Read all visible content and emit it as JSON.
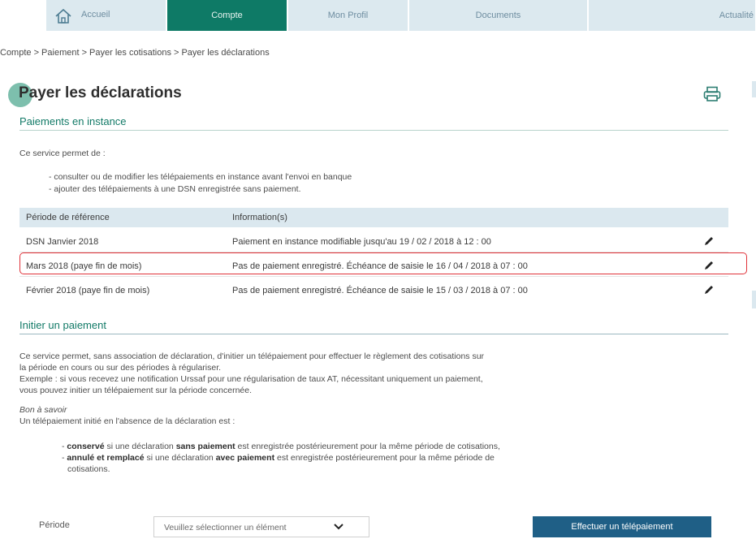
{
  "nav": {
    "items": [
      {
        "label": "Accueil"
      },
      {
        "label": "Compte"
      },
      {
        "label": "Mon Profil"
      },
      {
        "label": "Documents"
      },
      {
        "label": "Actualité"
      }
    ]
  },
  "breadcrumb": "Compte > Paiement > Payer les cotisations > Payer les déclarations",
  "page_title": "Payer les déclarations",
  "pending": {
    "title": "Paiements en instance",
    "intro": "Ce service permet de :",
    "bullets": [
      "- consulter ou de modifier les télépaiements en instance avant l'envoi en banque",
      "- ajouter des télépaiements à une DSN enregistrée sans paiement."
    ],
    "table": {
      "headers": [
        "Période de référence",
        "Information(s)"
      ],
      "rows": [
        {
          "period": "DSN Janvier 2018",
          "info": "Paiement en instance modifiable jusqu'au 19 / 02 / 2018  à  12 : 00"
        },
        {
          "period": "Mars 2018 (paye fin de mois)",
          "info": "Pas de paiement enregistré. Échéance de saisie le 16 / 04 / 2018  à  07 : 00"
        },
        {
          "period": "Février 2018 (paye fin de mois)",
          "info": "Pas de paiement enregistré. Échéance de saisie le 15 / 03 / 2018  à  07 : 00"
        }
      ]
    }
  },
  "initiate": {
    "title": "Initier un paiement",
    "p1_line1": "Ce service permet, sans association de déclaration, d'initier un télépaiement pour effectuer le règlement des cotisations sur",
    "p1_line2": "la période en cours ou sur des périodes à régulariser.",
    "p1_line3": "Exemple : si vous recevez une notification Urssaf pour une régularisation de taux AT, nécessitant uniquement un paiement,",
    "p1_line4": "vous pouvez initier un télépaiement sur la période concernée.",
    "good_to_know": "Bon à savoir",
    "p2": "Un télépaiement initié en l'absence de la déclaration est :",
    "b1_prefix": "- ",
    "b1_bold1": "conservé",
    "b1_mid": " si une déclaration ",
    "b1_bold2": "sans paiement",
    "b1_rest": " est enregistrée postérieurement pour la même période de cotisations,",
    "b2_prefix": "- ",
    "b2_bold1": "annulé et remplacé",
    "b2_mid": " si une déclaration ",
    "b2_bold2": "avec paiement",
    "b2_rest": " est enregistrée postérieurement pour la même période de",
    "b2_line2": "cotisations.",
    "period_label": "Période",
    "select_value": "Veuillez sélectionner un élément",
    "pay_button": "Effectuer un télépaiement"
  },
  "colors": {
    "nav_active": "#0e7a66",
    "nav_inactive": "#dce9ef",
    "section_title": "#127a67",
    "highlight": "#e0333a",
    "button": "#1f5f86"
  },
  "icons": [
    "home-icon",
    "printer-icon",
    "pencil-icon",
    "chevron-down-icon"
  ]
}
